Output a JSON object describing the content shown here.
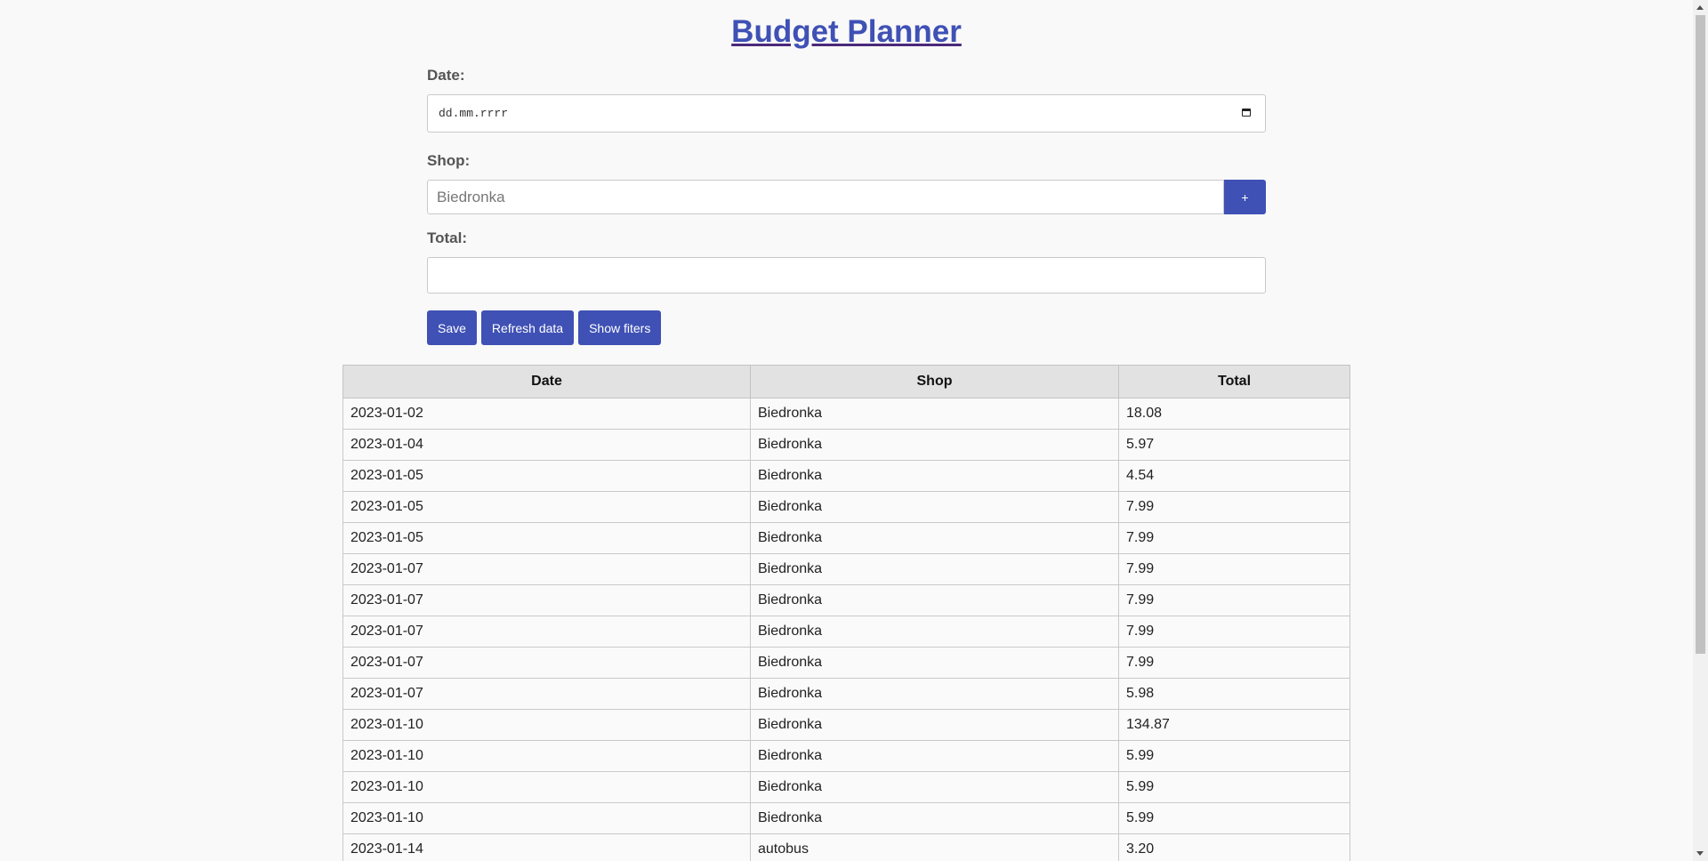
{
  "header": {
    "title": "Budget Planner"
  },
  "form": {
    "date_label": "Date:",
    "date_placeholder": "dd.mm.rrrr",
    "shop_label": "Shop:",
    "shop_placeholder": "Biedronka",
    "add_shop_label": "+",
    "total_label": "Total:",
    "total_value": ""
  },
  "actions": {
    "save_label": "Save",
    "refresh_label": "Refresh data",
    "filters_label": "Show fiters"
  },
  "table": {
    "headers": [
      "Date",
      "Shop",
      "Total"
    ],
    "rows": [
      [
        "2023-01-02",
        "Biedronka",
        "18.08"
      ],
      [
        "2023-01-04",
        "Biedronka",
        "5.97"
      ],
      [
        "2023-01-05",
        "Biedronka",
        "4.54"
      ],
      [
        "2023-01-05",
        "Biedronka",
        "7.99"
      ],
      [
        "2023-01-05",
        "Biedronka",
        "7.99"
      ],
      [
        "2023-01-07",
        "Biedronka",
        "7.99"
      ],
      [
        "2023-01-07",
        "Biedronka",
        "7.99"
      ],
      [
        "2023-01-07",
        "Biedronka",
        "7.99"
      ],
      [
        "2023-01-07",
        "Biedronka",
        "7.99"
      ],
      [
        "2023-01-07",
        "Biedronka",
        "5.98"
      ],
      [
        "2023-01-10",
        "Biedronka",
        "134.87"
      ],
      [
        "2023-01-10",
        "Biedronka",
        "5.99"
      ],
      [
        "2023-01-10",
        "Biedronka",
        "5.99"
      ],
      [
        "2023-01-10",
        "Biedronka",
        "5.99"
      ],
      [
        "2023-01-14",
        "autobus",
        "3.20"
      ]
    ]
  },
  "icons": {
    "date_picker": "calendar-icon"
  },
  "colors": {
    "accent": "#3f51b5",
    "page_bg": "#f9f9f9",
    "table_header_bg": "#e2e2e2"
  }
}
